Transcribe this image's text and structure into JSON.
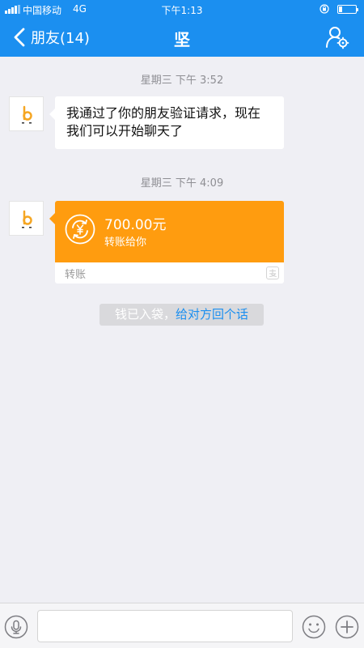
{
  "status_bar": {
    "carrier": "中国移动",
    "network": "4G",
    "time": "下午1:13",
    "icons": [
      "signal-icon",
      "rotation-lock-icon",
      "battery-icon"
    ]
  },
  "nav": {
    "back_label": "朋友(14)",
    "title": "坚",
    "back_icon": "chevron-left-icon",
    "profile_icon": "user-settings-icon"
  },
  "messages": [
    {
      "timestamp": "星期三 下午 3:52",
      "type": "text",
      "text": "我通过了你的朋友验证请求，现在我们可以开始聊天了"
    },
    {
      "timestamp": "星期三 下午 4:09",
      "type": "transfer",
      "amount": "700.00元",
      "description": "转账给你",
      "footer": "转账"
    }
  ],
  "system_notice": {
    "text": "钱已入袋，",
    "link": "给对方回个话"
  },
  "input_bar": {
    "placeholder": "",
    "icons": [
      "microphone-icon",
      "emoji-icon",
      "plus-icon"
    ]
  },
  "colors": {
    "header": "#1b8ff0",
    "transfer_orange": "#ff9c0f",
    "background": "#efeff4",
    "link": "#1b8ff0"
  }
}
